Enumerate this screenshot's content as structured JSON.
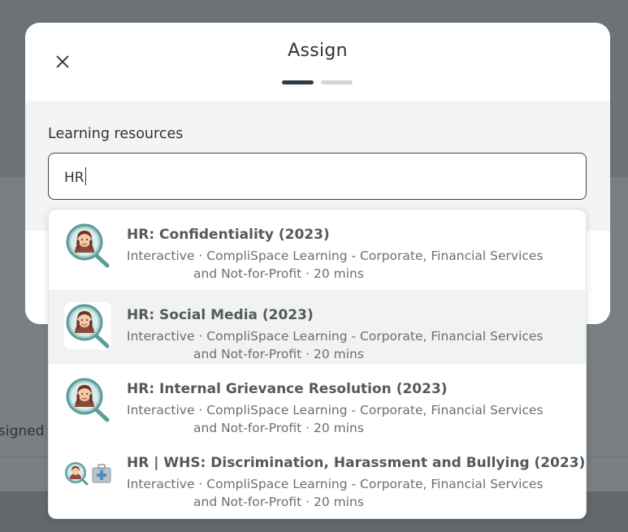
{
  "background": {
    "partial_text": "signed"
  },
  "modal": {
    "title": "Assign",
    "steps_total": 2,
    "current_step": 1
  },
  "field": {
    "label": "Learning resources",
    "value": "HR"
  },
  "results": [
    {
      "title": "HR: Confidentiality (2023)",
      "meta_line1": "Interactive · CompliSpace Learning - Corporate, Financial Services",
      "meta_line2": "and Not-for-Profit · 20 mins",
      "icon": "hr-character-magnifier-icon",
      "highlighted": false
    },
    {
      "title": "HR: Social Media (2023)",
      "meta_line1": "Interactive · CompliSpace Learning - Corporate, Financial Services",
      "meta_line2": "and Not-for-Profit · 20 mins",
      "icon": "hr-character-magnifier-icon",
      "highlighted": true
    },
    {
      "title": "HR: Internal Grievance Resolution (2023)",
      "meta_line1": "Interactive · CompliSpace Learning - Corporate, Financial Services",
      "meta_line2": "and Not-for-Profit · 20 mins",
      "icon": "hr-character-magnifier-icon",
      "highlighted": false
    },
    {
      "title": "HR | WHS: Discrimination, Harassment and Bullying (2023)",
      "meta_line1": "Interactive · CompliSpace Learning - Corporate, Financial Services",
      "meta_line2": "and Not-for-Profit · 20 mins",
      "icon": "hr-whs-first-aid-icon",
      "highlighted": false
    }
  ],
  "colors": {
    "accent": "#2f3a42",
    "overlay": "#6f7579"
  }
}
